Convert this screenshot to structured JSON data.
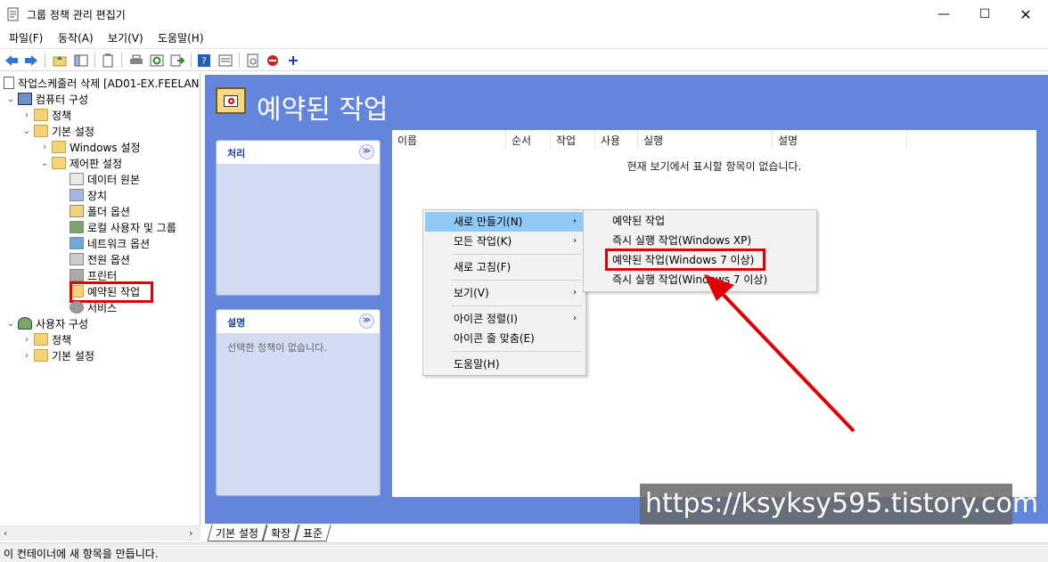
{
  "window": {
    "title": "그룹 정책 관리 편집기",
    "controls": {
      "minimize": "—",
      "maximize": "☐",
      "close": "✕"
    }
  },
  "menubar": [
    "파일(F)",
    "동작(A)",
    "보기(V)",
    "도움말(H)"
  ],
  "toolbar": {
    "icons": [
      "back-icon",
      "forward-icon",
      "up-folder-icon",
      "show-hide-tree-icon",
      "properties-icon",
      "print-icon",
      "refresh-icon",
      "export-list-icon",
      "help-icon",
      "view-icon",
      "task-icon",
      "stop-icon",
      "add-icon"
    ]
  },
  "tree": {
    "root": "작업스케줄러 삭제 [AD01-EX.FEELAN",
    "items": [
      {
        "label": "컴퓨터 구성",
        "level": 0,
        "expanded": true
      },
      {
        "label": "정책",
        "level": 1,
        "expanded": false
      },
      {
        "label": "기본 설정",
        "level": 1,
        "expanded": true
      },
      {
        "label": "Windows 설정",
        "level": 2,
        "expanded": false
      },
      {
        "label": "제어판 설정",
        "level": 2,
        "expanded": true
      },
      {
        "label": "데이터 원본",
        "level": 3
      },
      {
        "label": "장치",
        "level": 3
      },
      {
        "label": "폴더 옵션",
        "level": 3
      },
      {
        "label": "로컬 사용자 및 그룹",
        "level": 3
      },
      {
        "label": "네트워크 옵션",
        "level": 3
      },
      {
        "label": "전원 옵션",
        "level": 3
      },
      {
        "label": "프린터",
        "level": 3
      },
      {
        "label": "예약된 작업",
        "level": 3,
        "selected": true
      },
      {
        "label": "서비스",
        "level": 3
      },
      {
        "label": "사용자 구성",
        "level": 0,
        "expanded": true
      },
      {
        "label": "정책",
        "level": 1,
        "expanded": false
      },
      {
        "label": "기본 설정",
        "level": 1,
        "expanded": false
      }
    ]
  },
  "content": {
    "title": "예약된 작업",
    "panel_process": {
      "title": "처리",
      "collapse": "≫"
    },
    "panel_desc": {
      "title": "설명",
      "text": "선택한 정책이 없습니다.",
      "collapse": "≫"
    },
    "columns": [
      "이름",
      "순서",
      "작업",
      "사용",
      "실행",
      "설명"
    ],
    "empty_text": "현재 보기에서 표시할 항목이 없습니다."
  },
  "context_menu": {
    "items": [
      {
        "label": "새로 만들기(N)",
        "submenu": true,
        "highlighted": true
      },
      {
        "label": "모든 작업(K)",
        "submenu": true
      },
      {
        "label": "새로 고침(F)"
      },
      {
        "label": "보기(V)",
        "submenu": true
      },
      {
        "label": "아이콘 정렬(I)",
        "submenu": true
      },
      {
        "label": "아이콘 줄 맞춤(E)"
      },
      {
        "label": "도움말(H)"
      }
    ],
    "submenu": [
      "예약된 작업",
      "즉시 실행 작업(Windows XP)",
      "예약된 작업(Windows 7 이상)",
      "즉시 실행 작업(Windows 7 이상)"
    ]
  },
  "tabs": [
    "기본 설정",
    "확장",
    "표준"
  ],
  "status_text": "이 컨테이너에 새 항목을 만듭니다.",
  "watermark": "https://ksyksy595.tistory.com",
  "colors": {
    "pane_blue": "#6385dc",
    "highlight_red": "#e00000",
    "menu_hover": "#91c9f7"
  }
}
